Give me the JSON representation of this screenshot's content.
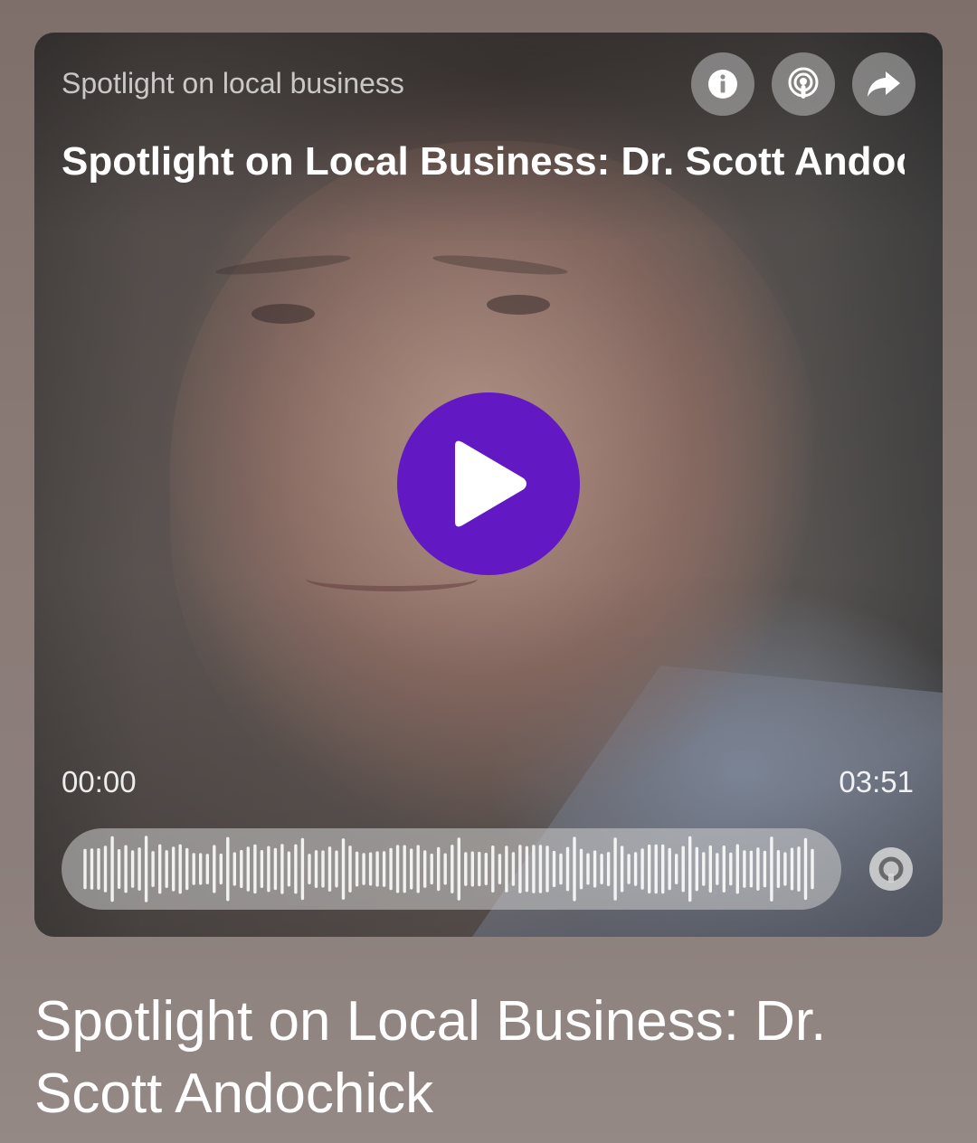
{
  "player": {
    "category": "Spotlight on local business",
    "title": "Spotlight on Local Business: Dr. Scott Andochick",
    "current_time": "00:00",
    "duration": "03:51",
    "progress": 0,
    "play_color": "#6219c4",
    "buttons": {
      "info": "info-icon",
      "podcast": "podcast-icon",
      "share": "share-arrow-icon",
      "play": "play-icon",
      "speed": "playback-speed-icon"
    }
  },
  "caption": {
    "title": "Spotlight on Local Business: Dr. Scott Andochick"
  }
}
